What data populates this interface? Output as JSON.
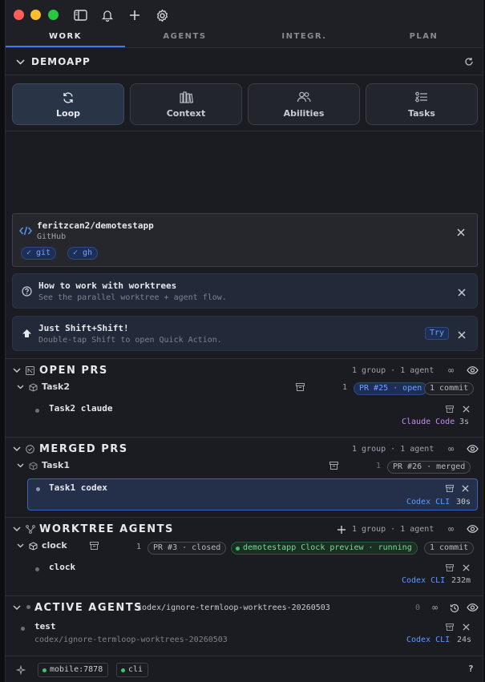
{
  "window": {
    "traffic": [
      "#ff5f57",
      "#febc2e",
      "#28c840"
    ],
    "toolbar_icons": [
      "sidebar-toggle-icon",
      "bell-icon",
      "plus-icon",
      "gear-icon"
    ]
  },
  "tabs": [
    {
      "label": "WORK",
      "active": true
    },
    {
      "label": "AGENTS",
      "active": false
    },
    {
      "label": "INTEGR.",
      "active": false
    },
    {
      "label": "PLAN",
      "active": false
    }
  ],
  "project": {
    "name": "DEMOAPP"
  },
  "modes": [
    {
      "label": "Loop",
      "icon": "loop-icon",
      "active": true
    },
    {
      "label": "Context",
      "icon": "books-icon",
      "active": false
    },
    {
      "label": "Abilities",
      "icon": "people-icon",
      "active": false
    },
    {
      "label": "Tasks",
      "icon": "checklist-icon",
      "active": false
    }
  ],
  "repo": {
    "name": "feritzcan2/demotestapp",
    "host": "GitHub",
    "badges": [
      "✓ git",
      "✓ gh"
    ]
  },
  "notes": [
    {
      "title": "How to work with worktrees",
      "subtitle": "See the parallel worktree + agent flow."
    },
    {
      "title": "Just Shift+Shift!",
      "subtitle": "Double-tap Shift to open Quick Action.",
      "action": "Try"
    }
  ],
  "sections": {
    "open_prs": {
      "title": "OPEN PRS",
      "meta": "1 group · 1 agent",
      "group": {
        "name": "Task2",
        "count": "1",
        "pr": "PR #25 · open",
        "commits": "1 commit"
      },
      "agent": {
        "name": "Task2 claude",
        "tool": "Claude Code",
        "time": "3s"
      }
    },
    "merged_prs": {
      "title": "MERGED PRS",
      "meta": "1 group · 1 agent",
      "group": {
        "name": "Task1",
        "count": "1",
        "pr": "PR #26 · merged"
      },
      "agent": {
        "name": "Task1 codex",
        "tool": "Codex CLI",
        "time": "30s"
      }
    },
    "worktree_agents": {
      "title": "WORKTREE AGENTS",
      "meta": "1 group · 1 agent",
      "group": {
        "name": "clock",
        "count": "1",
        "pr": "PR #3 · closed",
        "preview": "demotestapp Clock preview · running",
        "commits": "1 commit"
      },
      "agent": {
        "name": "clock",
        "tool": "Codex CLI",
        "time": "232m"
      }
    },
    "active_agents": {
      "title": "ACTIVE AGENTS",
      "branch": "codex/ignore-termloop-worktrees-20260503",
      "count": "0",
      "agent": {
        "name": "test",
        "branch": "codex/ignore-termloop-worktrees-20260503",
        "tool": "Codex CLI",
        "time": "24s"
      }
    }
  },
  "infinity": "∞",
  "statusbar": {
    "chips": [
      "mobile:7878",
      "cli"
    ],
    "help": "?"
  },
  "colors": {
    "accent": "#3b7cf6",
    "claude": "#c48cf0",
    "codex": "#5b9bff",
    "green": "#3fc66a"
  }
}
